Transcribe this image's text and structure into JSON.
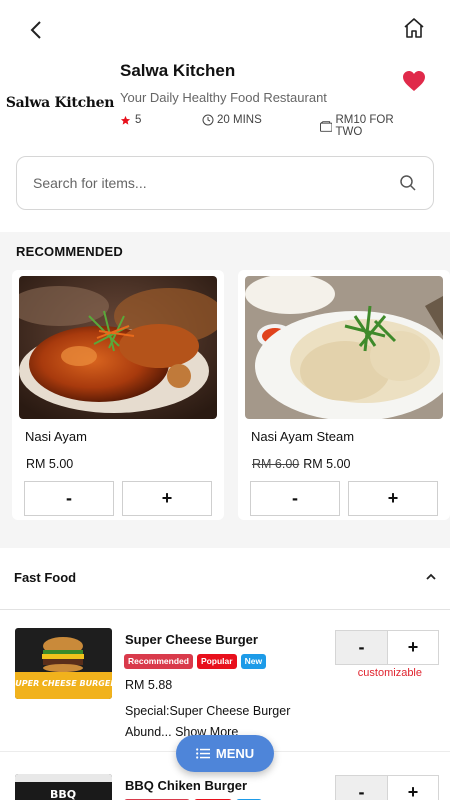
{
  "restaurant": {
    "logo_text": "Salwa Kitchen",
    "name": "Salwa Kitchen",
    "tagline": "Your Daily Healthy Food Restaurant",
    "rating": "5",
    "time": "20 MINS",
    "cost": "RM10 FOR TWO"
  },
  "search": {
    "placeholder": "Search for items..."
  },
  "recommended": {
    "title": "RECOMMENDED",
    "items": [
      {
        "name": "Nasi Ayam",
        "old_price": "",
        "price": "RM 5.00",
        "minus": "-",
        "plus": "+"
      },
      {
        "name": "Nasi Ayam Steam",
        "old_price": "RM 6.00",
        "price": "RM 5.00",
        "minus": "-",
        "plus": "+"
      }
    ]
  },
  "category": {
    "title": "Fast Food",
    "items": [
      {
        "name": "Super Cheese Burger",
        "badges": [
          "Recommended",
          "Popular",
          "New"
        ],
        "price": "RM 5.88",
        "desc": "Special:Super Cheese Burger Abund...",
        "more": "Show More",
        "minus": "-",
        "plus": "+",
        "note": "customizable",
        "image_text": "SUPER CHEESE BURGER"
      },
      {
        "name": "BBQ Chiken Burger",
        "minus": "-",
        "plus": "+",
        "image_text": "BBQ"
      }
    ]
  },
  "menu_button": {
    "label": "MENU"
  },
  "colors": {
    "accent": "#4e85d9",
    "heart": "#e02a4a",
    "note": "#e0242f"
  }
}
